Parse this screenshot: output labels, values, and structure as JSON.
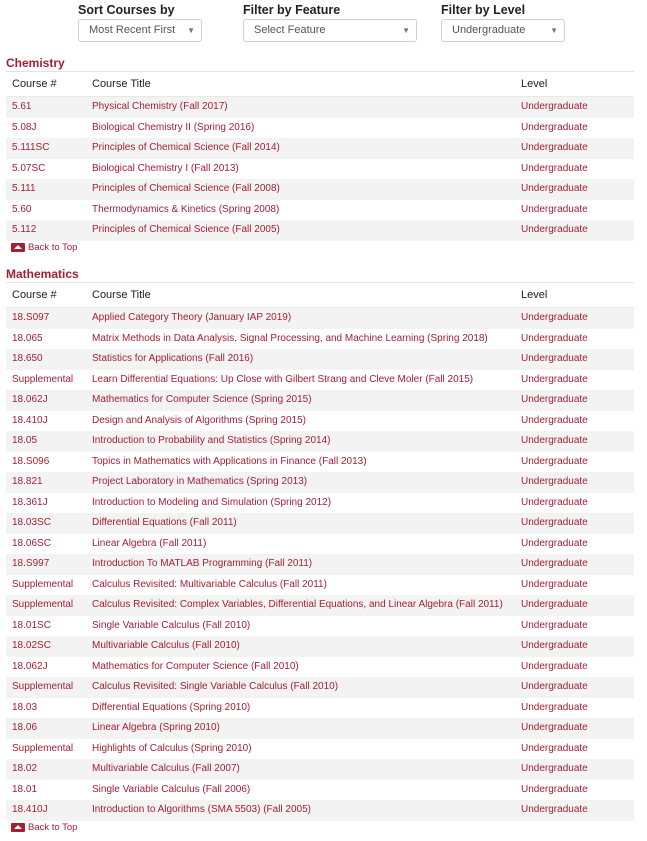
{
  "filters": {
    "sort": {
      "label": "Sort Courses by",
      "value": "Most Recent First"
    },
    "feature": {
      "label": "Filter by Feature",
      "value": "Select Feature"
    },
    "level": {
      "label": "Filter by Level",
      "value": "Undergraduate"
    }
  },
  "headers": {
    "number": "Course #",
    "title": "Course Title",
    "level": "Level"
  },
  "back_to_top": "Back to Top",
  "colors": {
    "accent": "#a31f34"
  },
  "sections": [
    {
      "name": "Chemistry",
      "rows": [
        [
          "5.61",
          "Physical Chemistry (Fall 2017)",
          "Undergraduate"
        ],
        [
          "5.08J",
          "Biological Chemistry II (Spring 2016)",
          "Undergraduate"
        ],
        [
          "5.111SC",
          "Principles of Chemical Science (Fall 2014)",
          "Undergraduate"
        ],
        [
          "5.07SC",
          "Biological Chemistry I (Fall 2013)",
          "Undergraduate"
        ],
        [
          "5.111",
          "Principles of Chemical Science (Fall 2008)",
          "Undergraduate"
        ],
        [
          "5.60",
          "Thermodynamics & Kinetics (Spring 2008)",
          "Undergraduate"
        ],
        [
          "5.112",
          "Principles of Chemical Science (Fall 2005)",
          "Undergraduate"
        ]
      ]
    },
    {
      "name": "Mathematics",
      "rows": [
        [
          "18.S097",
          "Applied Category Theory (January IAP 2019)",
          "Undergraduate"
        ],
        [
          "18.065",
          "Matrix Methods in Data Analysis, Signal Processing, and Machine Learning (Spring 2018)",
          "Undergraduate"
        ],
        [
          "18.650",
          "Statistics for Applications (Fall 2016)",
          "Undergraduate"
        ],
        [
          "Supplemental",
          "Learn Differential Equations: Up Close with Gilbert Strang and Cleve Moler (Fall 2015)",
          "Undergraduate"
        ],
        [
          "18.062J",
          "Mathematics for Computer Science (Spring 2015)",
          "Undergraduate"
        ],
        [
          "18.410J",
          "Design and Analysis of Algorithms (Spring 2015)",
          "Undergraduate"
        ],
        [
          "18.05",
          "Introduction to Probability and Statistics (Spring 2014)",
          "Undergraduate"
        ],
        [
          "18.S096",
          "Topics in Mathematics with Applications in Finance (Fall 2013)",
          "Undergraduate"
        ],
        [
          "18.821",
          "Project Laboratory in Mathematics (Spring 2013)",
          "Undergraduate"
        ],
        [
          "18.361J",
          "Introduction to Modeling and Simulation (Spring 2012)",
          "Undergraduate"
        ],
        [
          "18.03SC",
          "Differential Equations (Fall 2011)",
          "Undergraduate"
        ],
        [
          "18.06SC",
          "Linear Algebra (Fall 2011)",
          "Undergraduate"
        ],
        [
          "18.S997",
          "Introduction To MATLAB Programming (Fall 2011)",
          "Undergraduate"
        ],
        [
          "Supplemental",
          "Calculus Revisited: Multivariable Calculus (Fall 2011)",
          "Undergraduate"
        ],
        [
          "Supplemental",
          "Calculus Revisited: Complex Variables, Differential Equations, and Linear Algebra (Fall 2011)",
          "Undergraduate"
        ],
        [
          "18.01SC",
          "Single Variable Calculus (Fall 2010)",
          "Undergraduate"
        ],
        [
          "18.02SC",
          "Multivariable Calculus (Fall 2010)",
          "Undergraduate"
        ],
        [
          "18.062J",
          "Mathematics for Computer Science (Fall 2010)",
          "Undergraduate"
        ],
        [
          "Supplemental",
          "Calculus Revisited: Single Variable Calculus (Fall 2010)",
          "Undergraduate"
        ],
        [
          "18.03",
          "Differential Equations (Spring 2010)",
          "Undergraduate"
        ],
        [
          "18.06",
          "Linear Algebra (Spring 2010)",
          "Undergraduate"
        ],
        [
          "Supplemental",
          "Highlights of Calculus (Spring 2010)",
          "Undergraduate"
        ],
        [
          "18.02",
          "Multivariable Calculus (Fall 2007)",
          "Undergraduate"
        ],
        [
          "18.01",
          "Single Variable Calculus (Fall 2006)",
          "Undergraduate"
        ],
        [
          "18.410J",
          "Introduction to Algorithms (SMA 5503) (Fall 2005)",
          "Undergraduate"
        ]
      ]
    }
  ]
}
